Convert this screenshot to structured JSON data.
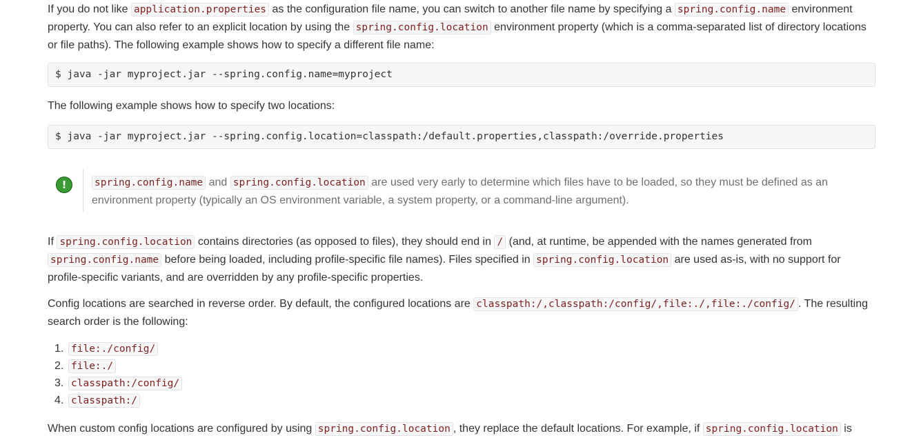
{
  "para1": {
    "t1": "If you do not like ",
    "c1": "application.properties",
    "t2": " as the configuration file name, you can switch to another file name by specifying a ",
    "c2": "spring.config.name",
    "t3": " environment property. You can also refer to an explicit location by using the ",
    "c3": "spring.config.location",
    "t4": " environment property (which is a comma-separated list of directory locations or file paths). The following example shows how to specify a different file name:"
  },
  "listing1": "$ java -jar myproject.jar --spring.config.name=myproject",
  "para2": "The following example shows how to specify two locations:",
  "listing2": "$ java -jar myproject.jar --spring.config.location=classpath:/default.properties,classpath:/override.properties",
  "admonition": {
    "icon": "warning-exclamation-icon",
    "icon_glyph": "!",
    "icon_color": "#3a9a33",
    "c1": "spring.config.name",
    "t1": " and ",
    "c2": "spring.config.location",
    "t2": " are used very early to determine which files have to be loaded, so they must be defined as an environment property (typically an OS environment variable, a system property, or a command-line argument)."
  },
  "para3": {
    "t1": "If ",
    "c1": "spring.config.location",
    "t2": " contains directories (as opposed to files), they should end in ",
    "c2": "/",
    "t3": " (and, at runtime, be appended with the names generated from ",
    "c3": "spring.config.name",
    "t4": " before being loaded, including profile-specific file names). Files specified in ",
    "c4": "spring.config.location",
    "t5": " are used as-is, with no support for profile-specific variants, and are overridden by any profile-specific properties."
  },
  "para4": {
    "t1": "Config locations are searched in reverse order. By default, the configured locations are ",
    "c1": "classpath:/,classpath:/config/,file:./,file:./config/",
    "t2": ". The resulting search order is the following:"
  },
  "search_order": [
    {
      "num": "1.",
      "value": "file:./config/"
    },
    {
      "num": "2.",
      "value": "file:./"
    },
    {
      "num": "3.",
      "value": "classpath:/config/"
    },
    {
      "num": "4.",
      "value": "classpath:/"
    }
  ],
  "para5": {
    "t1": "When custom config locations are configured by using ",
    "c1": "spring.config.location",
    "t2": ", they replace the default locations. For example, if ",
    "c2": "spring.config.location",
    "t3": " is"
  }
}
